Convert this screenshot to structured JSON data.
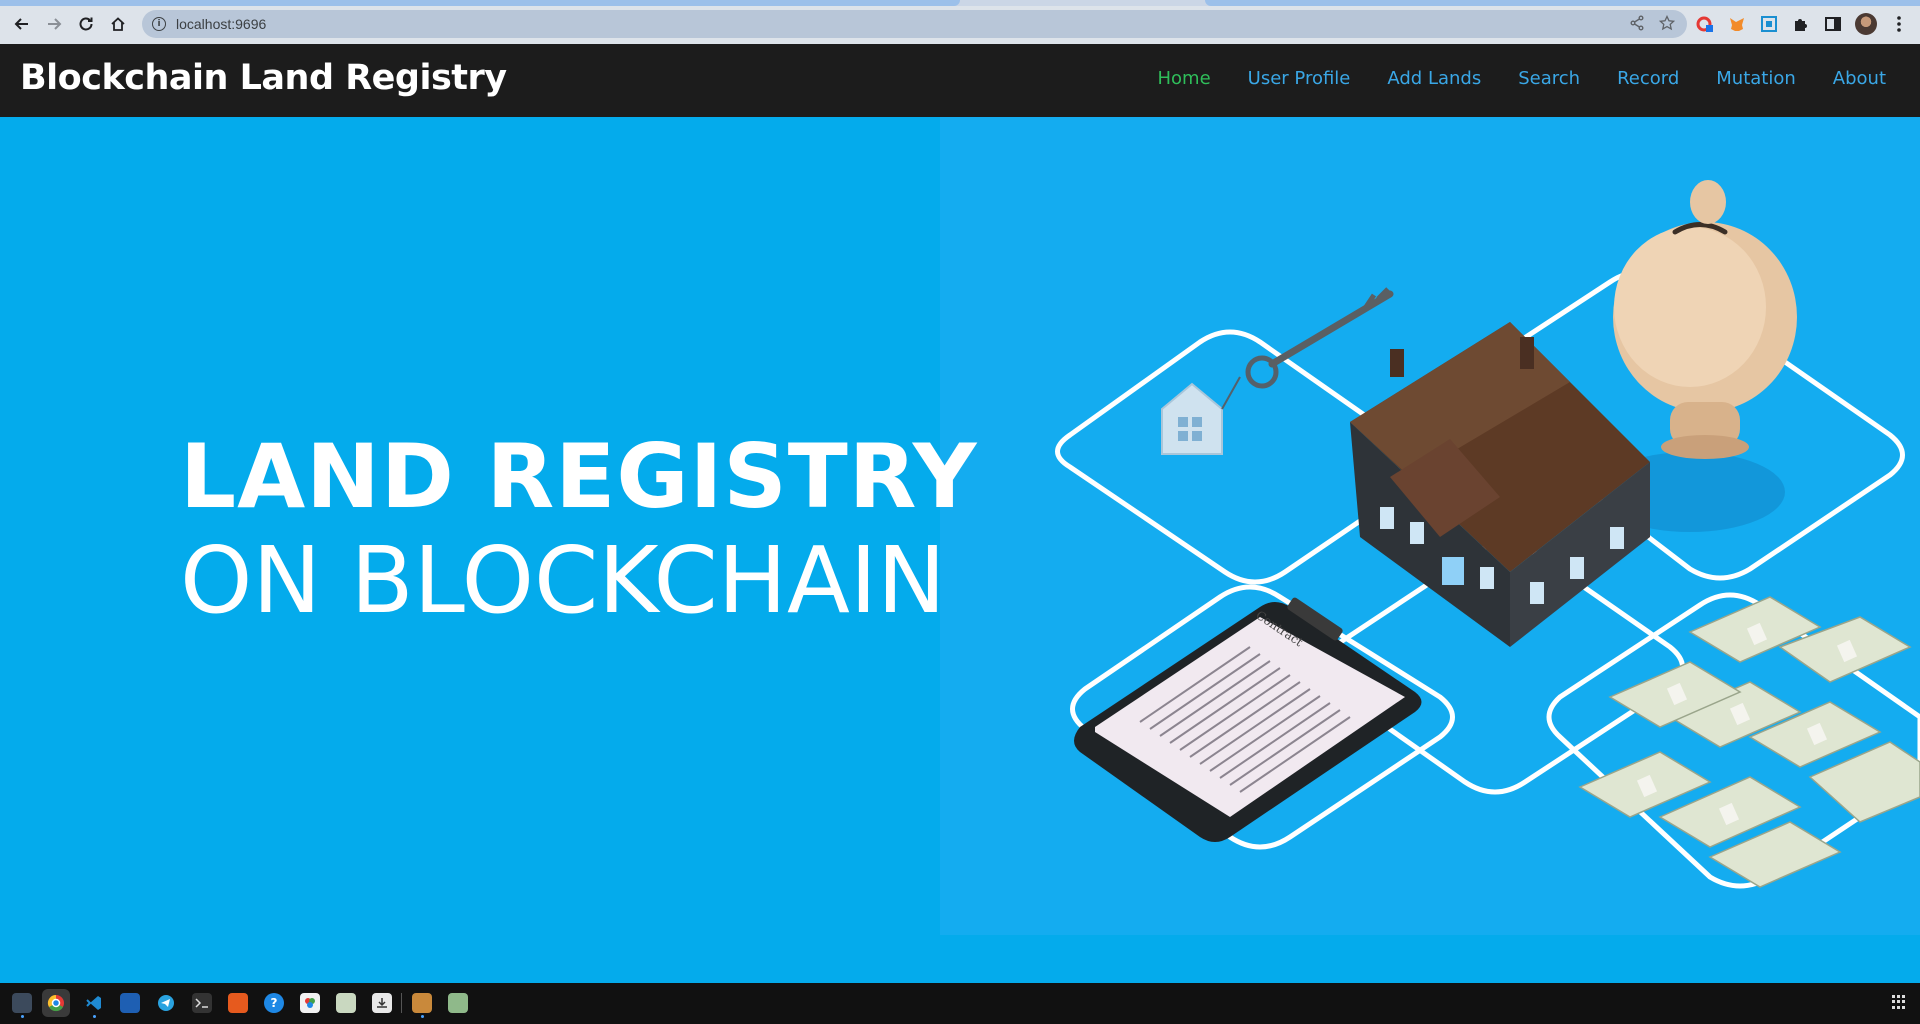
{
  "browser": {
    "url": "localhost:9696"
  },
  "site": {
    "brand": "Blockchain Land Registry",
    "nav": [
      {
        "label": "Home",
        "active": true
      },
      {
        "label": "User Profile",
        "active": false
      },
      {
        "label": "Add Lands",
        "active": false
      },
      {
        "label": "Search",
        "active": false
      },
      {
        "label": "Record",
        "active": false
      },
      {
        "label": "Mutation",
        "active": false
      },
      {
        "label": "About",
        "active": false
      }
    ]
  },
  "hero": {
    "line1": "LAND REGISTRY",
    "line2": "ON BLOCKCHAIN",
    "contract_label": "Contract"
  },
  "colors": {
    "navbar_bg": "#1c1c1c",
    "nav_link": "#3aa7e6",
    "nav_active": "#2fbe5a",
    "hero_bg": "#04abec"
  },
  "taskbar": {
    "icons": [
      "files-icon",
      "chrome-icon",
      "vscode-icon",
      "text-editor-icon",
      "telegram-icon",
      "terminal-icon",
      "software-center-icon",
      "help-icon",
      "settings-icon",
      "image-viewer-icon",
      "downloads-icon",
      "package-icon",
      "trash-icon",
      "app-grid-icon"
    ]
  }
}
